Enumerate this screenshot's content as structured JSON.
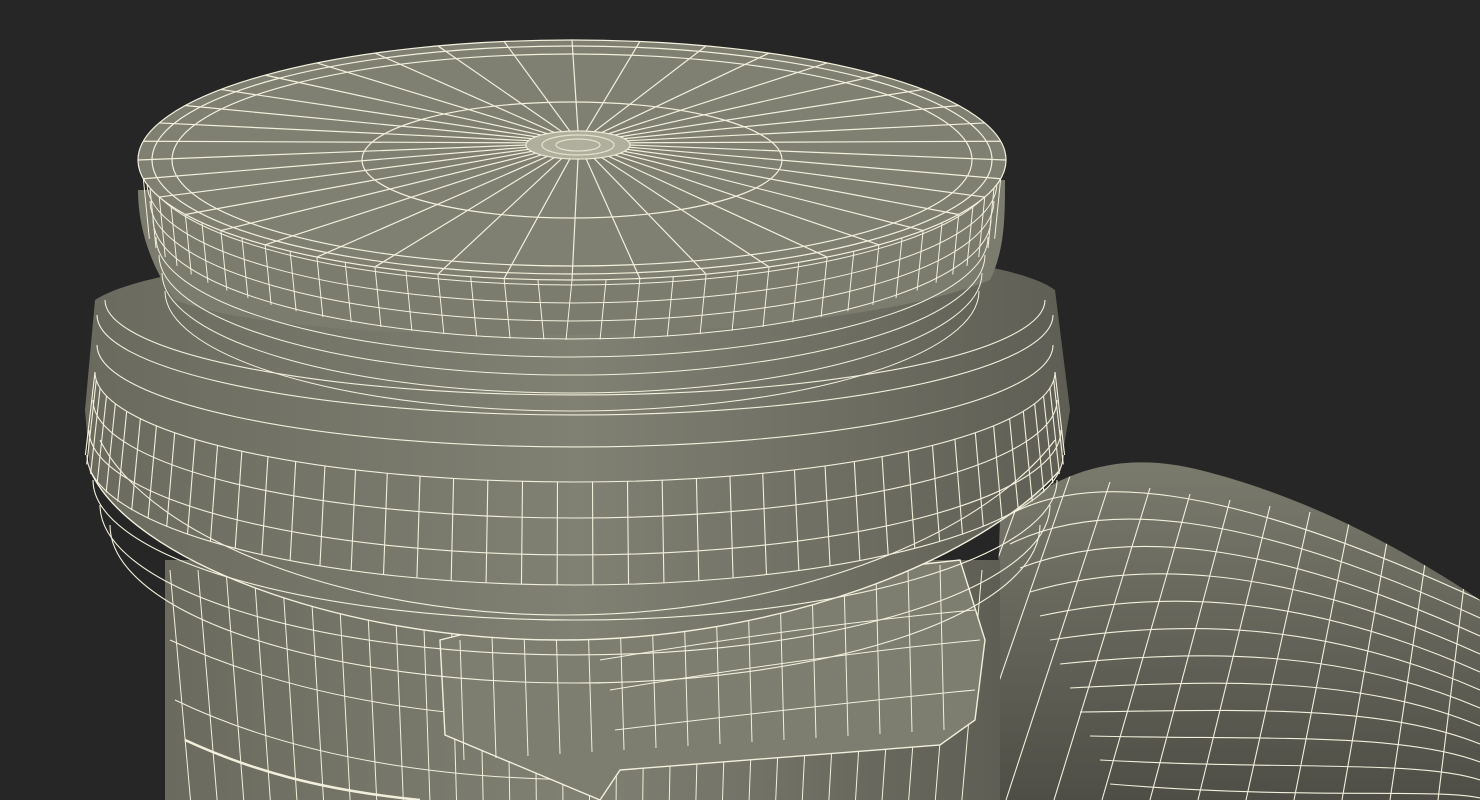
{
  "scene": {
    "background": "#262626",
    "surface_fill": "#7c7c6f",
    "surface_fill_dark": "#55554c",
    "surface_fill_light": "#8a8a7d",
    "wire_color": "#f2f0dc",
    "icon": "wireframe-mesh-icon"
  }
}
